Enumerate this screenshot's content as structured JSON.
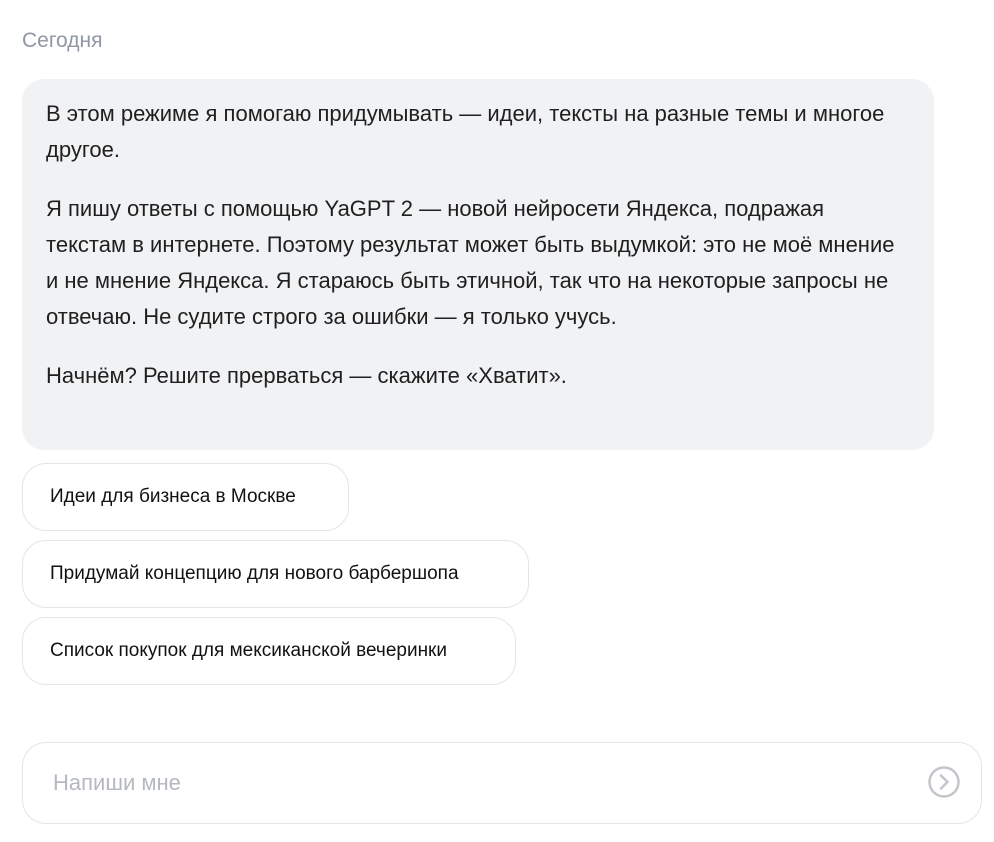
{
  "chat": {
    "date_label": "Сегодня",
    "message": {
      "paragraphs": [
        "В этом режиме я помогаю придумывать — идеи, тексты на разные темы и многое другое.",
        "Я пишу ответы с помощью YaGPT 2 — новой нейросети Яндекса, подражая текстам в интернете. Поэтому результат может быть выдумкой: это не моё мнение и не мнение Яндекса. Я стараюсь быть этичной, так что на некоторые запросы не отвечаю. Не судите строго за ошибки — я только учусь.",
        "Начнём? Решите прерваться — скажите «Хватит»."
      ]
    },
    "suggestions": [
      "Идеи для бизнеса в Москве",
      "Придумай концепцию для нового барбершопа",
      "Список покупок для мексиканской вечеринки"
    ]
  },
  "composer": {
    "placeholder": "Напиши мне",
    "value": "",
    "send_icon": "chevron-right-circle-icon"
  },
  "colors": {
    "bubble_background": "#f1f2f4",
    "date_text": "#8e97a3",
    "border": "#e3e5e9",
    "placeholder": "#b5b9bf",
    "send_icon": "#c2c5ca"
  }
}
